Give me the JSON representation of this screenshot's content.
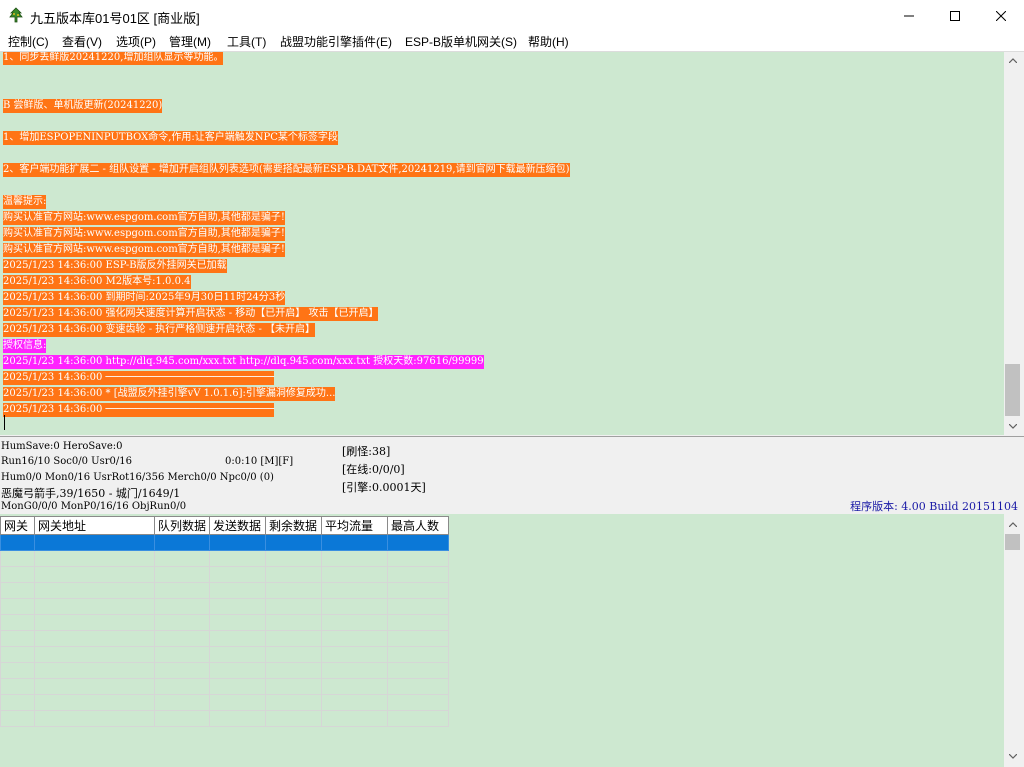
{
  "window": {
    "title": "九五版本库01号01区 [商业版]",
    "icon": "tree-icon"
  },
  "menu": [
    {
      "label": "控制(C)"
    },
    {
      "label": "查看(V)"
    },
    {
      "label": "选项(P)"
    },
    {
      "label": "管理(M)"
    },
    {
      "label": "工具(T)"
    },
    {
      "label": "战盟功能引擎插件(E)"
    },
    {
      "label": "ESP-B版单机网关(S)"
    },
    {
      "label": "帮助(H)"
    }
  ],
  "log": [
    {
      "text": "1、同步丢鲜版20241220,增加组队显示等功能。",
      "style": "orange"
    },
    {
      "text": "",
      "style": "none"
    },
    {
      "text": "",
      "style": "none"
    },
    {
      "text": "B 尝鲜版、单机版更新(20241220)",
      "style": "orange"
    },
    {
      "text": "",
      "style": "none"
    },
    {
      "text": "1、增加ESPOPENINPUTBOX命令,作用:让客户端触发NPC某个标签字段",
      "style": "orange"
    },
    {
      "text": "",
      "style": "none"
    },
    {
      "text": "2、客户端功能扩展二 - 组队设置 - 增加开启组队列表选项(需要搭配最新ESP-B.DAT文件,20241219,请到官网下载最新压缩包)",
      "style": "orange"
    },
    {
      "text": "",
      "style": "none"
    },
    {
      "text": "温馨提示:",
      "style": "orange"
    },
    {
      "text": "购买认准官方网站:www.espgom.com官方自助,其他都是骗子!",
      "style": "orange"
    },
    {
      "text": "购买认准官方网站:www.espgom.com官方自助,其他都是骗子!",
      "style": "orange"
    },
    {
      "text": "购买认准官方网站:www.espgom.com官方自助,其他都是骗子!",
      "style": "orange"
    },
    {
      "text": "2025/1/23 14:36:00 ESP-B版反外挂网关已加载",
      "style": "orange"
    },
    {
      "text": "2025/1/23 14:36:00 M2版本号:1.0.0.4",
      "style": "orange"
    },
    {
      "text": "2025/1/23 14:36:00 到期时间:2025年9月30日11时24分3秒",
      "style": "orange"
    },
    {
      "text": "2025/1/23 14:36:00 强化网关速度计算开启状态 - 移动【已开启】 攻击【已开启】",
      "style": "orange"
    },
    {
      "text": "2025/1/23 14:36:00 变速齿轮 - 执行严格侧速开启状态 - 【未开启】",
      "style": "orange"
    },
    {
      "text": "授权信息:",
      "style": "magenta"
    },
    {
      "text": "2025/1/23 14:36:00 http://dlq.945.com/xxx.txt http://dlq.945.com/xxx.txt 授权天数:97616/99999",
      "style": "magenta"
    },
    {
      "text": "2025/1/23 14:36:00 ────────────────────────────",
      "style": "orange"
    },
    {
      "text": "2025/1/23 14:36:00 * [战盟反外挂引擎vV 1.0.1.6]:引擎漏洞修复成功...",
      "style": "orange"
    },
    {
      "text": "2025/1/23 14:36:00 ────────────────────────────",
      "style": "orange"
    }
  ],
  "status": {
    "left": [
      "HumSave:0 HeroSave:0",
      "Run16/10 Soc0/0 Usr0/16",
      "Hum0/0 Mon0/16 UsrRot16/356 Merch0/0 Npc0/0 (0)",
      "恶魔弓箭手,39/1650 - 城门/1649/1",
      "MonG0/0/0 MonP0/16/16 ObjRun0/0"
    ],
    "timer": "0:0:10 [M][F]",
    "refresh": "[刷怪:38]",
    "online": "[在线:0/0/0]",
    "engine": "[引擎:0.0001天]",
    "version": "程序版本: 4.00 Build 20151104"
  },
  "grid": {
    "columns": [
      "网关",
      "网关地址",
      "队列数据",
      "发送数据",
      "剩余数据",
      "平均流量",
      "最高人数"
    ],
    "row_count": 12
  },
  "colors": {
    "background_green": "#cde8d0",
    "highlight_orange": "#ff7415",
    "highlight_magenta": "#ff22ff",
    "selection_blue": "#0b78d7",
    "version_text": "#1a1aa6"
  }
}
